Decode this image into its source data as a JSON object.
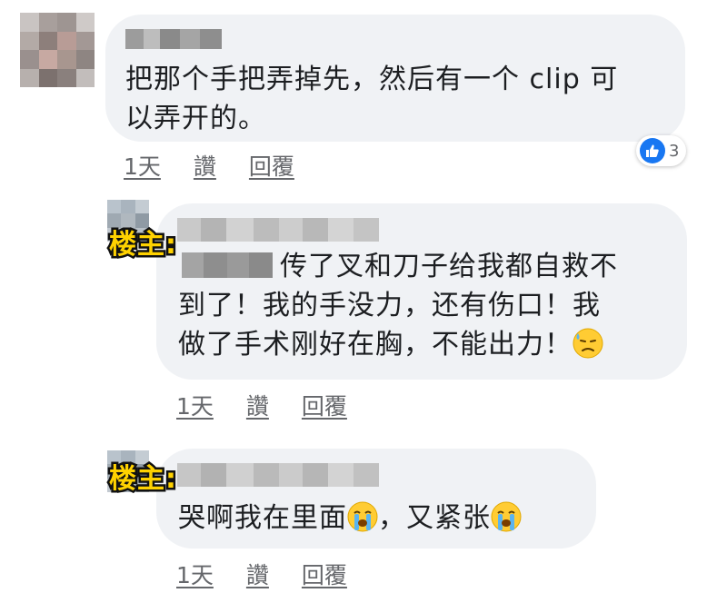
{
  "comments": [
    {
      "text_lines": [
        "把那个手把弄掉先，然后有一个 clip 可",
        "以弄开的。"
      ],
      "actions": {
        "time": "1天",
        "like": "讚",
        "reply": "回覆"
      },
      "reaction": {
        "icon": "like-icon",
        "count": "3"
      }
    },
    {
      "tag": "楼主:",
      "text_lines": [
        "传了叉和刀子给我都自救不",
        "到了！我的手没力，还有伤口！我",
        "做了手术刚好在胸，不能出力！"
      ],
      "trailing_emoji": "downcast-sweat-face-emoji",
      "actions": {
        "time": "1天",
        "like": "讚",
        "reply": "回覆"
      }
    },
    {
      "tag": "楼主:",
      "segments": [
        "哭啊我在里面",
        "，又紧张"
      ],
      "emojis": [
        "loudly-crying-face-emoji",
        "loudly-crying-face-emoji"
      ],
      "actions": {
        "time": "1天",
        "like": "讚",
        "reply": "回覆"
      }
    }
  ],
  "colors": {
    "bubble": "#f0f2f5",
    "text": "#1c1e21",
    "meta": "#65676b",
    "tag_fill": "#ffd200",
    "tag_stroke": "#111111",
    "like_blue": "#1877f2"
  }
}
